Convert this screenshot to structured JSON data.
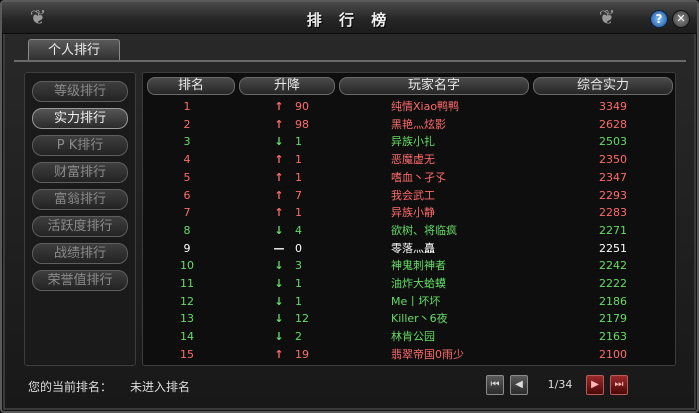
{
  "window": {
    "title": "排 行 榜"
  },
  "titlebar": {
    "help_label": "?",
    "close_label": "✕"
  },
  "tab": {
    "label": "个人排行"
  },
  "sidebar": {
    "items": [
      {
        "label": "等级排行",
        "active": false
      },
      {
        "label": "实力排行",
        "active": true
      },
      {
        "label": "P K排行",
        "active": false
      },
      {
        "label": "财富排行",
        "active": false
      },
      {
        "label": "富翁排行",
        "active": false
      },
      {
        "label": "活跃度排行",
        "active": false
      },
      {
        "label": "战绩排行",
        "active": false
      },
      {
        "label": "荣誉值排行",
        "active": false
      }
    ]
  },
  "table": {
    "headers": [
      "排名",
      "升降",
      "玩家名字",
      "综合实力"
    ],
    "rows": [
      {
        "rank": "1",
        "dir": "up",
        "change": "90",
        "name": "纯情Xiao鸭鸭",
        "power": "3349"
      },
      {
        "rank": "2",
        "dir": "up",
        "change": "98",
        "name": "黑艳灬炫影",
        "power": "2628"
      },
      {
        "rank": "3",
        "dir": "down",
        "change": "1",
        "name": "异族小扎",
        "power": "2503"
      },
      {
        "rank": "4",
        "dir": "up",
        "change": "1",
        "name": "恶魔虚无",
        "power": "2350"
      },
      {
        "rank": "5",
        "dir": "up",
        "change": "1",
        "name": "嗜血丶孑孓",
        "power": "2347"
      },
      {
        "rank": "6",
        "dir": "up",
        "change": "7",
        "name": "我会武工",
        "power": "2293"
      },
      {
        "rank": "7",
        "dir": "up",
        "change": "1",
        "name": "异族小静",
        "power": "2283"
      },
      {
        "rank": "8",
        "dir": "down",
        "change": "4",
        "name": "欲树、将临疯",
        "power": "2271"
      },
      {
        "rank": "9",
        "dir": "none",
        "change": "0",
        "name": "零落灬矗",
        "power": "2251"
      },
      {
        "rank": "10",
        "dir": "down",
        "change": "3",
        "name": "神鬼刺神者",
        "power": "2242"
      },
      {
        "rank": "11",
        "dir": "down",
        "change": "1",
        "name": "油炸大蛤蟆",
        "power": "2222"
      },
      {
        "rank": "12",
        "dir": "down",
        "change": "1",
        "name": "Me丨坏坏",
        "power": "2186"
      },
      {
        "rank": "13",
        "dir": "down",
        "change": "12",
        "name": "Killer丶6夜",
        "power": "2179"
      },
      {
        "rank": "14",
        "dir": "down",
        "change": "2",
        "name": "林肯公园",
        "power": "2163"
      },
      {
        "rank": "15",
        "dir": "up",
        "change": "19",
        "name": "翡翠帝国0雨少",
        "power": "2100"
      }
    ]
  },
  "arrows": {
    "up": "↑",
    "down": "↓",
    "none": "—"
  },
  "status": {
    "label": "您的当前排名：",
    "value": "未进入排名"
  },
  "pagination": {
    "indicator": "1/34",
    "first_label": "⏮",
    "prev_label": "◀",
    "next_label": "▶",
    "last_label": "⏭"
  },
  "colors": {
    "up": "#ff6b6b",
    "down": "#66dd66",
    "none": "#ffffff"
  }
}
